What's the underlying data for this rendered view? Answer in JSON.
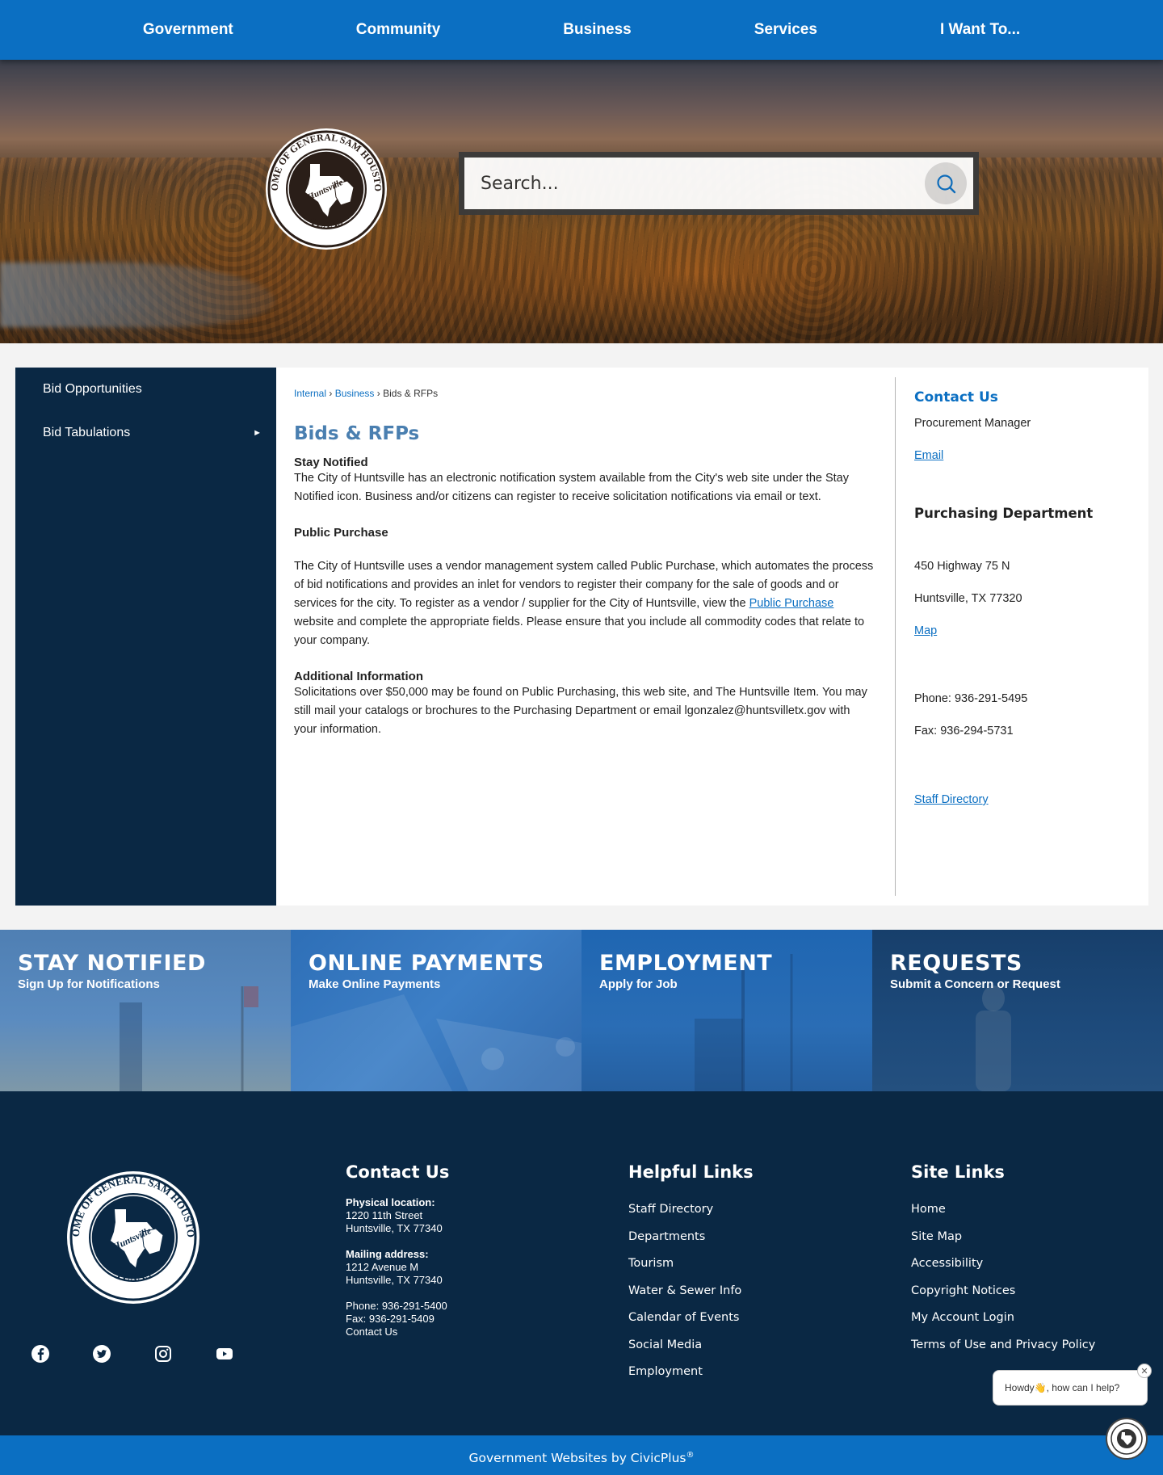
{
  "nav": {
    "items": [
      "Government",
      "Community",
      "Business",
      "Services",
      "I Want To..."
    ]
  },
  "hero": {
    "logo_text": "HOME OF GENERAL SAM HOUSTON · City of Huntsville · TEXAS",
    "search_placeholder": "Search..."
  },
  "sidebar": {
    "items": [
      {
        "label": "Bid Opportunities"
      },
      {
        "label": "Bid Tabulations",
        "arrow": "►"
      }
    ]
  },
  "breadcrumb": {
    "items": [
      "Internal",
      "Business"
    ],
    "separator": "›",
    "current": "Bids & RFPs"
  },
  "main": {
    "title": "Bids & RFPs",
    "stay_notified": {
      "heading": "Stay Notified",
      "text": "The City of Huntsville has an electronic notification system available from the City's web site under the Stay Notified icon.  Business and/or citizens can register to receive solicitation notifications via email or text."
    },
    "public_purchase": {
      "heading": "Public Purchase",
      "text_before": "The City of Huntsville uses a vendor management system called Public Purchase, which automates the process of bid notifications and provides an inlet for vendors to register their company for the sale of goods and or services for the city. To register as a vendor / supplier for the City of Huntsville, view the ",
      "link": "Public Purchase",
      "text_after": " website and complete the appropriate fields. Please ensure that you include all commodity codes that relate to your company."
    },
    "additional": {
      "heading": "Additional Information",
      "text": "Solicitations over $50,000 may be found on Public Purchasing, this web site, and The Huntsville Item. You may still mail your catalogs or brochures to the Purchasing Department or email lgonzalez@huntsvilletx.gov with your information."
    }
  },
  "contact_box": {
    "heading": "Contact Us",
    "role": "Procurement Manager",
    "email_link": "Email",
    "department": "Purchasing Department",
    "address1": "450 Highway 75 N",
    "address2": "Huntsville, TX  77320",
    "map_link": "Map",
    "phone": "Phone: 936-291-5495",
    "fax": "Fax: 936-294-5731",
    "staff_link": "Staff Directory"
  },
  "tiles": [
    {
      "title": "STAY NOTIFIED",
      "subtitle": "Sign Up for Notifications"
    },
    {
      "title": "ONLINE PAYMENTS",
      "subtitle": "Make Online Payments"
    },
    {
      "title": "EMPLOYMENT",
      "subtitle": "Apply for Job"
    },
    {
      "title": "REQUESTS",
      "subtitle": "Submit a Concern or Request"
    }
  ],
  "footer": {
    "contact": {
      "heading": "Contact Us",
      "physical_label": "Physical location:",
      "physical_line1": "1220 11th Street",
      "physical_line2": "Huntsville, TX 77340",
      "mailing_label": "Mailing address:",
      "mailing_line1": "1212 Avenue M",
      "mailing_line2": "Huntsville, TX 77340",
      "phone": "Phone: 936-291-5400",
      "fax": "Fax: 936-291-5409",
      "contact_link": "Contact Us"
    },
    "helpful": {
      "heading": "Helpful Links",
      "links": [
        "Staff Directory",
        "Departments",
        "Tourism",
        "Water & Sewer Info",
        "Calendar of Events",
        "Social Media",
        "Employment"
      ]
    },
    "site": {
      "heading": "Site Links",
      "links": [
        "Home",
        "Site Map",
        "Accessibility",
        "Copyright Notices",
        "My Account Login",
        "Terms of Use and Privacy Policy"
      ]
    },
    "socials": [
      "facebook-icon",
      "twitter-icon",
      "instagram-icon",
      "youtube-icon"
    ]
  },
  "chat": {
    "message": "Howdy👋, how can I help?",
    "close": "✕"
  },
  "bottom": {
    "text": "Government Websites by CivicPlus",
    "reg": "®"
  },
  "colors": {
    "nav_blue": "#0b6fc2",
    "navy": "#0a2844",
    "link_blue": "#0b6fc2",
    "title_blue": "#4a7fb0"
  }
}
